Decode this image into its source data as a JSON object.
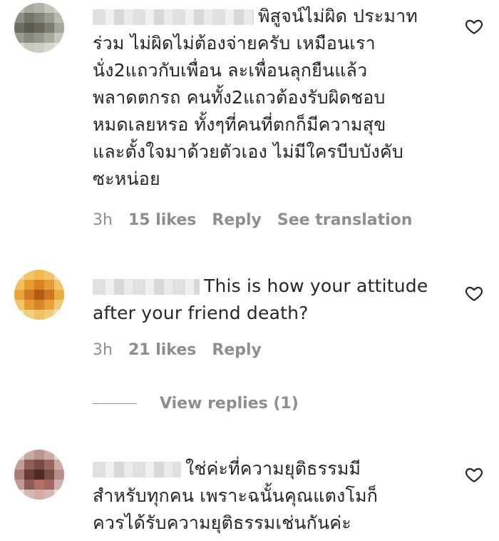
{
  "comments": [
    {
      "text": "พิสูจน์ไม่ผิด ประมาท\nร่วม ไม่ผิดไม่ต้องจ่ายครับ เหมือนเรา\nนั่ง2แถวกับเพื่อน ละเพื่อนลุกยืนแล้ว\nพลาดตกรถ คนทั้ง2แถวต้องรับผิดชอบ\nหมดเลยหรอ ทั้งๆที่คนที่ตกก็มีความสุข\nและตั้งใจมาด้วยตัวเอง ไม่มีใครบีบบังคับ\nซะหน่อย",
      "time": "3h",
      "likes": "15 likes",
      "reply": "Reply",
      "translate": "See translation",
      "heart_icon": "heart-outline-icon"
    },
    {
      "text": "This is how your attitude\nafter your friend death?",
      "time": "3h",
      "likes": "21 likes",
      "reply": "Reply",
      "heart_icon": "heart-outline-icon"
    },
    {
      "text": "ใช่ค่ะที่ความยุติธรรมมี\nสำหรับทุกคน เพราะฉนั้นคุณแตงโมก็\nควรได้รับความยุติธรรมเช่นกันค่ะ",
      "heart_icon": "heart-outline-icon"
    }
  ],
  "view_replies": "View replies (1)",
  "colors": {
    "text": "#262626",
    "secondary": "#8e8e8e"
  }
}
